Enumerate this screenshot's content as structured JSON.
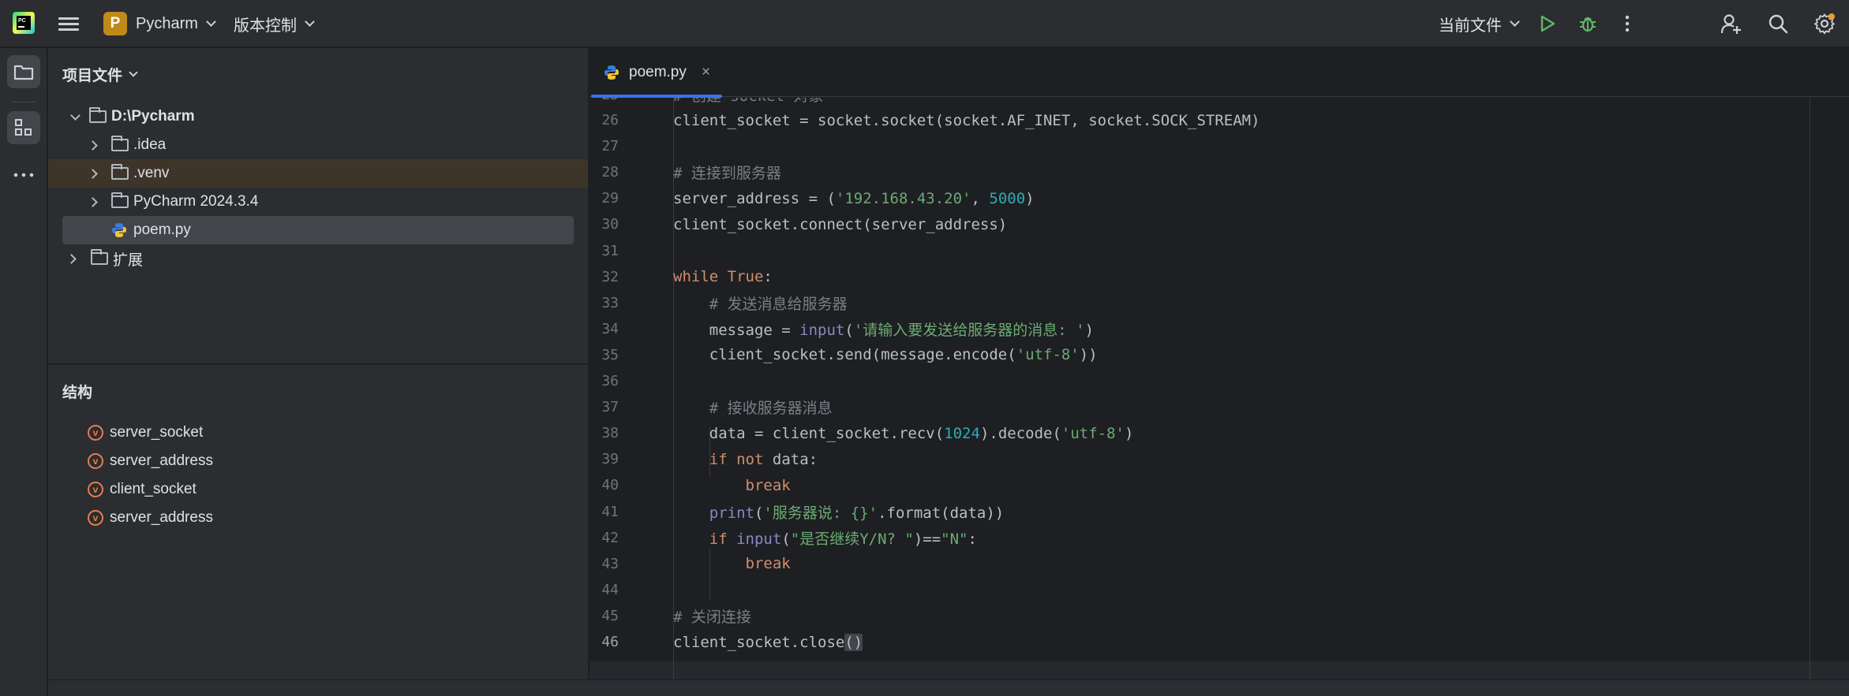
{
  "titlebar": {
    "project_initial": "P",
    "project_name": "Pycharm",
    "vcs_label": "版本控制",
    "run_config": "当前文件"
  },
  "project_panel": {
    "title": "项目文件",
    "tree": [
      {
        "label": "D:\\Pycharm",
        "bold": true,
        "depth": 0,
        "expanded": true
      },
      {
        "label": ".idea",
        "depth": 1
      },
      {
        "label": ".venv",
        "depth": 1
      },
      {
        "label": "PyCharm 2024.3.4",
        "depth": 1
      },
      {
        "label": "poem.py",
        "depth": 1,
        "file": true
      },
      {
        "label": "扩展",
        "depth": 0
      }
    ]
  },
  "structure_panel": {
    "title": "结构",
    "items": [
      "server_socket",
      "server_address",
      "client_socket",
      "server_address"
    ],
    "var_icon_glyph": "v"
  },
  "editor": {
    "tab_label": "poem.py",
    "tab_close": "×",
    "partial_top_line": "# 创建 socket 对象",
    "lines": [
      {
        "n": "26",
        "text": "client_socket = socket.socket(socket.AF_INET, socket.SOCK_STREAM)"
      },
      {
        "n": "27",
        "text": ""
      },
      {
        "n": "28",
        "text": "# 连接到服务器"
      },
      {
        "n": "29",
        "text": "server_address = ('192.168.43.20', 5000)"
      },
      {
        "n": "30",
        "text": "client_socket.connect(server_address)"
      },
      {
        "n": "31",
        "text": ""
      },
      {
        "n": "32",
        "text": "while True:"
      },
      {
        "n": "33",
        "text": "    # 发送消息给服务器"
      },
      {
        "n": "34",
        "text": "    message = input('请输入要发送给服务器的消息: ')"
      },
      {
        "n": "35",
        "text": "    client_socket.send(message.encode('utf-8'))"
      },
      {
        "n": "36",
        "text": ""
      },
      {
        "n": "37",
        "text": "    # 接收服务器消息"
      },
      {
        "n": "38",
        "text": "    data = client_socket.recv(1024).decode('utf-8')"
      },
      {
        "n": "39",
        "text": "    if not data:"
      },
      {
        "n": "40",
        "text": "        break"
      },
      {
        "n": "41",
        "text": "    print('服务器说: {}'.format(data))"
      },
      {
        "n": "42",
        "text": "    if input(\"是否继续Y/N? \")==\"N\":"
      },
      {
        "n": "43",
        "text": "        break"
      },
      {
        "n": "44",
        "text": ""
      },
      {
        "n": "45",
        "text": "# 关闭连接"
      },
      {
        "n": "46",
        "text": "client_socket.close()",
        "current": true
      }
    ]
  },
  "colors": {
    "accent": "#3574f0",
    "run_green": "#5fb865",
    "project_badge": "#c08a18",
    "keyword": "#cf8e6d",
    "string": "#6aab73",
    "number": "#2aacb8",
    "comment": "#7a7e85"
  },
  "icons": {
    "app_logo": "pycharm-logo-icon",
    "menu": "hamburger-menu-icon",
    "run": "run-icon",
    "debug": "debug-icon",
    "more": "more-vertical-icon",
    "add_user": "add-user-icon",
    "search": "search-icon",
    "settings": "gear-icon",
    "project_tool": "folder-icon",
    "structure_tool": "structure-icon",
    "more_tools": "more-horizontal-icon"
  }
}
